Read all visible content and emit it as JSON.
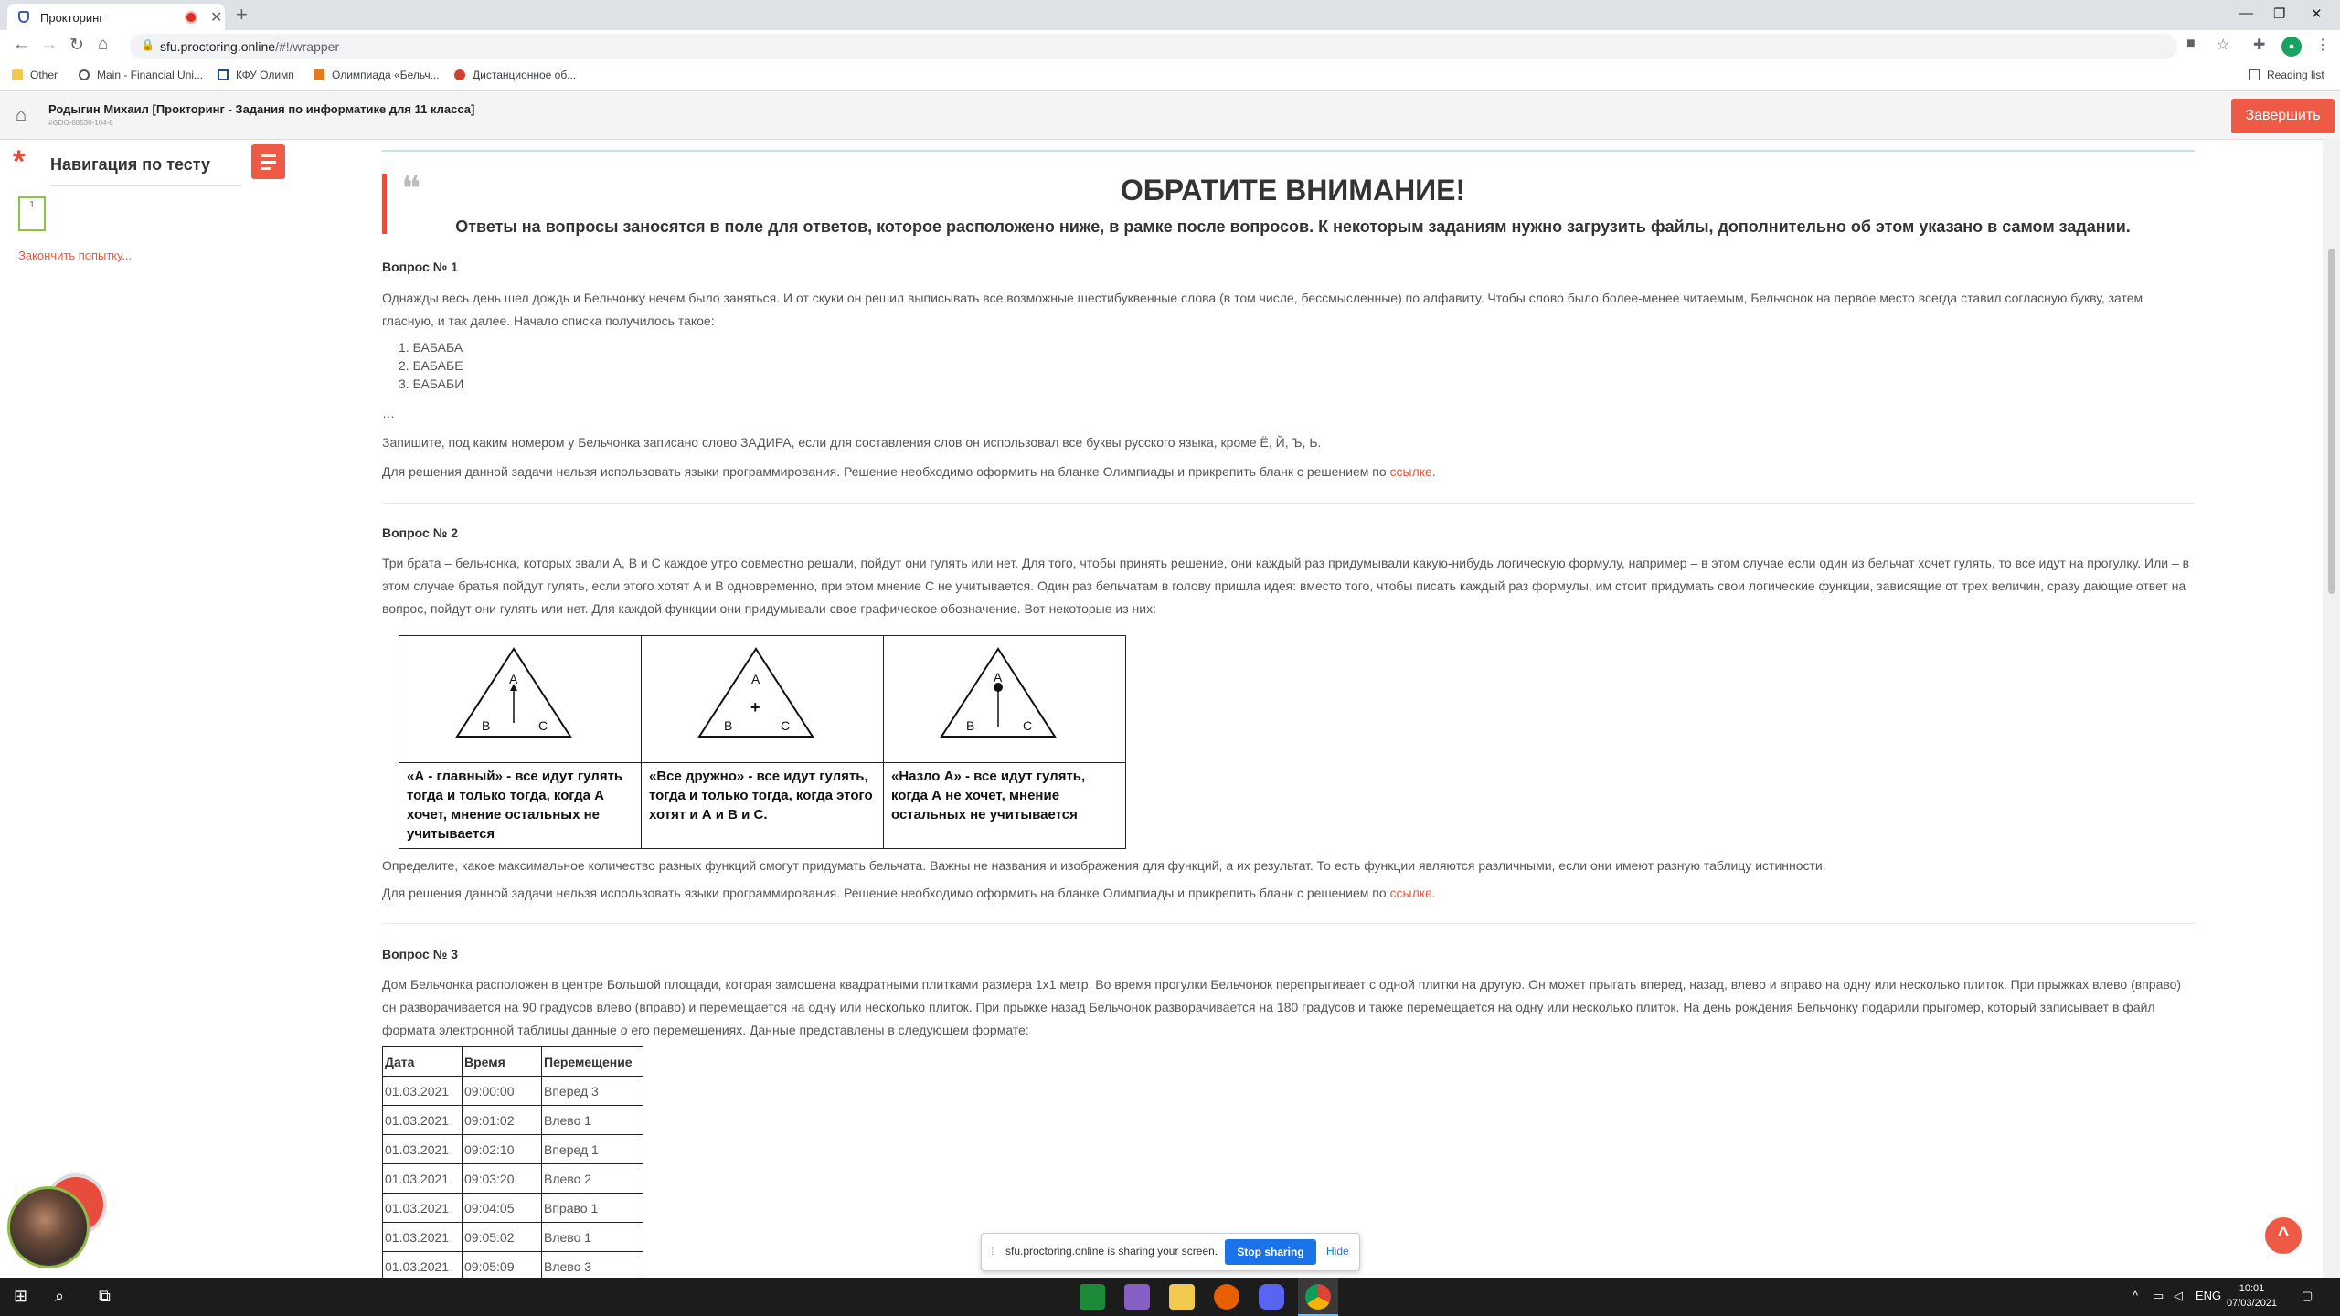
{
  "browser": {
    "tab_title": "Прокторинг",
    "url_host": "sfu.proctoring.online",
    "url_path": "/#!/wrapper",
    "bookmarks": [
      "Other",
      "Main - Financial Uni...",
      "КФУ Олимп",
      "Олимпиада «Бельч...",
      "Дистанционное об..."
    ],
    "reading_list": "Reading list"
  },
  "header": {
    "title": "Родыгин Михаил [Прокторинг - Задания по информатике для 11 класса]",
    "subtitle": "#GDO-88530-104-8",
    "finish_button": "Завершить"
  },
  "nav": {
    "title": "Навигация по тесту",
    "question_number": "1",
    "finish_attempt": "Закончить попытку..."
  },
  "notice": {
    "title": "ОБРАТИТЕ ВНИМАНИЕ!",
    "text": "Ответы на вопросы заносятся в поле для ответов, которое расположено ниже, в рамке после вопросов. К некоторым заданиям нужно загрузить файлы, дополнительно об этом указано в самом задании."
  },
  "q1": {
    "heading": "Вопрос № 1",
    "text": "Однажды весь день шел дождь и Бельчонку нечем было заняться. И от скуки он решил выписывать все возможные шестибуквенные слова (в том числе, бессмысленные) по алфавиту. Чтобы слово было более-менее читаемым, Бельчонок на первое место всегда ставил согласную букву, затем гласную, и так далее. Начало списка получилось такое:",
    "list": [
      "1. БАБАБА",
      "2. БАБАБЕ",
      "3. БАБАБИ"
    ],
    "ellipsis": "…",
    "task": "Запишите, под каким номером у Бельчонка записано слово ЗАДИРА, если для составления слов он использовал все буквы русского языка, кроме Ё, Й, Ъ, Ь.",
    "note": "Для решения данной задачи нельзя использовать языки программирования. Решение необходимо оформить на бланке Олимпиады и прикрепить бланк с решением по",
    "link": "ссылке",
    "dot": "."
  },
  "q2": {
    "heading": "Вопрос № 2",
    "text": "Три брата – бельчонка, которых звали A, B и C каждое утро совместно решали, пойдут они гулять или нет. Для того, чтобы принять решение, они каждый раз придумывали какую-нибудь логическую формулу, например  – в этом случае если один из бельчат хочет гулять, то все идут на прогулку. Или  – в этом случае братья пойдут гулять, если этого хотят A и B одновременно, при этом мнение C не учитывается. Один раз бельчатам в голову пришла идея: вместо того, чтобы писать каждый раз формулы, им стоит придумать свои логические функции, зависящие от трех величин, сразу дающие ответ на вопрос, пойдут они гулять или нет. Для каждой функции они придумывали свое графическое обозначение. Вот некоторые из них:",
    "functions": [
      {
        "a": "A",
        "b": "B",
        "c": "C",
        "caption": "«А - главный» - все идут гулять тогда и только тогда, когда А хочет, мнение остальных не учитывается"
      },
      {
        "a": "A",
        "b": "B",
        "c": "C",
        "caption": "«Все дружно» - все идут гулять, тогда и только тогда, когда этого хотят и А и В и С."
      },
      {
        "a": "A",
        "b": "B",
        "c": "C",
        "caption": "«Назло А» - все идут гулять, когда А не хочет, мнение остальных не учитывается"
      }
    ],
    "task": "Определите, какое максимальное количество разных функций смогут придумать бельчата. Важны не названия и изображения для функций, а их результат. То есть функции являются различными, если они имеют разную таблицу истинности.",
    "note": "Для решения данной задачи нельзя использовать языки программирования. Решение необходимо оформить на бланке Олимпиады и прикрепить бланк с решением по",
    "link": "ссылке",
    "dot": "."
  },
  "q3": {
    "heading": "Вопрос № 3",
    "text": "Дом Бельчонка расположен в центре Большой площади, которая замощена квадратными плитками размера 1х1 метр. Во время прогулки Бельчонок перепрыгивает с одной плитки на другую. Он может прыгать вперед, назад, влево и вправо на одну или несколько плиток. При прыжках влево (вправо) он разворачивается на 90 градусов влево (вправо) и перемещается на одну или несколько плиток. При прыжке назад Бельчонок разворачивается на 180 градусов и также перемещается на одну или несколько плиток. На день рождения Бельчонку подарили прыгомер, который записывает в файл формата электронной таблицы данные о его перемещениях. Данные представлены в следующем формате:",
    "columns": [
      "Дата",
      "Время",
      "Перемещение"
    ],
    "rows": [
      [
        "01.03.2021",
        "09:00:00",
        "Вперед 3"
      ],
      [
        "01.03.2021",
        "09:01:02",
        "Влево 1"
      ],
      [
        "01.03.2021",
        "09:02:10",
        "Вперед 1"
      ],
      [
        "01.03.2021",
        "09:03:20",
        "Влево 2"
      ],
      [
        "01.03.2021",
        "09:04:05",
        "Вправо 1"
      ],
      [
        "01.03.2021",
        "09:05:02",
        "Влево 1"
      ],
      [
        "01.03.2021",
        "09:05:09",
        "Влево 3"
      ]
    ]
  },
  "share": {
    "text": "sfu.proctoring.online is sharing your screen.",
    "stop": "Stop sharing",
    "hide": "Hide"
  },
  "taskbar": {
    "lang": "ENG",
    "time": "10:01",
    "date": "07/03/2021"
  }
}
